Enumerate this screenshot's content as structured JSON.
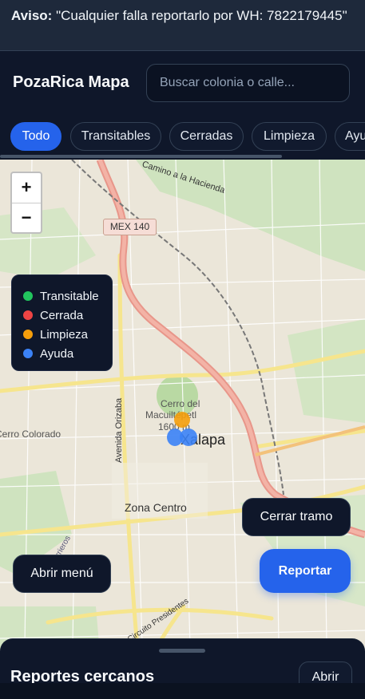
{
  "notice": {
    "label": "Aviso:",
    "text": "\"Cualquier falla reportarlo por WH: 7822179445\""
  },
  "header": {
    "brand": "PozaRica Mapa",
    "search_placeholder": "Buscar colonia o calle..."
  },
  "filters": [
    {
      "label": "Todo",
      "active": true
    },
    {
      "label": "Transitables",
      "active": false
    },
    {
      "label": "Cerradas",
      "active": false
    },
    {
      "label": "Limpieza",
      "active": false
    },
    {
      "label": "Ayuda",
      "active": false
    }
  ],
  "zoom": {
    "in": "+",
    "out": "−"
  },
  "legend": [
    {
      "label": "Transitable",
      "color": "#22c55e"
    },
    {
      "label": "Cerrada",
      "color": "#ef4444"
    },
    {
      "label": "Limpieza",
      "color": "#f59e0b"
    },
    {
      "label": "Ayuda",
      "color": "#3b82f6"
    }
  ],
  "map_labels": {
    "highway_shield": "MEX 140",
    "camino": "Camino a la Hacienda",
    "cerro_1": "Cerro del",
    "cerro_2": "Macuiltépetl",
    "cerro_3": "1600 m",
    "city": "Xalapa",
    "cerro_colorado": "Cerro Colorado",
    "avenida": "Avenida Orizaba",
    "zona_centro": "Zona Centro",
    "circuito": "Circuito Presidentes",
    "arrieros": "Arrieros"
  },
  "actions": {
    "open_menu": "Abrir menú",
    "close_segment": "Cerrar tramo",
    "report": "Reportar"
  },
  "sheet": {
    "title": "Reportes cercanos",
    "open": "Abrir"
  }
}
